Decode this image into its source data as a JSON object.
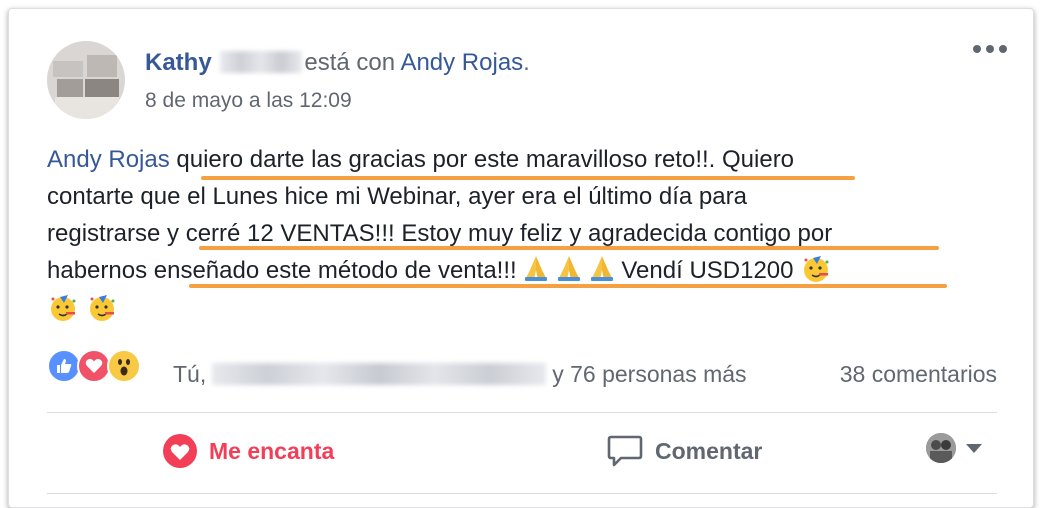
{
  "post": {
    "author_name": "Kathy",
    "with_text": "está con",
    "tagged_name": "Andy Rojas",
    "tagged_suffix": ".",
    "timestamp": "8 de mayo a las 12:09",
    "body": {
      "mention": "Andy Rojas",
      "line1_rest": " quiero darte las gracias por este maravilloso reto!!. Quiero",
      "line2": "contarte que el Lunes hice mi Webinar, ayer era el último día para",
      "line3": "registrarse y cerré 12 VENTAS!!! Estoy muy feliz y agradecida contigo por",
      "line4_a": "habernos enseñado este método de venta!!!",
      "line4_b": " Vendí USD1200 "
    }
  },
  "reactions": {
    "icons": [
      "like-icon",
      "love-icon",
      "wow-icon"
    ],
    "prefix": "Tú,",
    "suffix": "y 76 personas más",
    "comments": "38 comentarios"
  },
  "actions": {
    "love_label": "Me encanta",
    "comment_label": "Comentar"
  },
  "colors": {
    "link": "#365899",
    "love": "#f33e58",
    "highlight": "#f5a042",
    "like": "#5890ff"
  }
}
